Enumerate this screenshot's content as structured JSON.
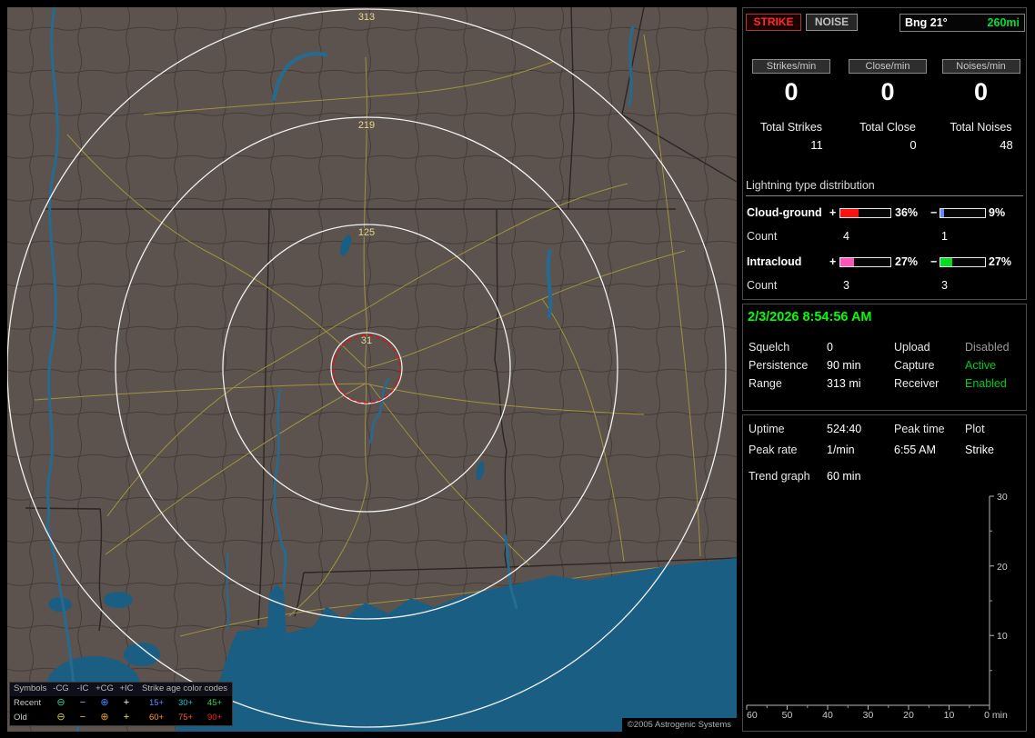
{
  "app": {
    "copyright": "©2005 Astrogenic Systems"
  },
  "colors": {
    "land": "#5c524e",
    "water": "#1a5f83",
    "road": "#a0923e",
    "range_ring": "#f2f2f2",
    "range_label": "#e6d98e",
    "alarm_circle": "#d31616",
    "strike_red": "#ff2a2a",
    "status_green": "#00ff00",
    "bar_plus_cg": "#ff1111",
    "bar_minus_cg": "#6688ff",
    "bar_plus_ic": "#ff55bb",
    "bar_minus_ic": "#00dd22"
  },
  "map": {
    "range_labels": [
      "313",
      "219",
      "125",
      "31"
    ],
    "legend": {
      "symbols_header": "Symbols",
      "col_headers": [
        "-CG",
        "-IC",
        "+CG",
        "+IC"
      ],
      "age_header": "Strike age color codes",
      "rows": [
        {
          "label": "Recent",
          "symbols": [
            "⊖",
            "−",
            "⊕",
            "+"
          ],
          "ages": [
            "15+",
            "30+",
            "45+"
          ]
        },
        {
          "label": "Old",
          "symbols": [
            "⊖",
            "−",
            "⊕",
            "+"
          ],
          "ages": [
            "60+",
            "75+",
            "90+"
          ]
        }
      ]
    }
  },
  "panel": {
    "tabs": {
      "strike": "STRIKE",
      "noise": "NOISE"
    },
    "bearing": {
      "label": "Bng 21°",
      "distance": "260mi"
    },
    "rates": {
      "strikes": {
        "label": "Strikes/min",
        "value": "0"
      },
      "close": {
        "label": "Close/min",
        "value": "0"
      },
      "noises": {
        "label": "Noises/min",
        "value": "0"
      }
    },
    "totals": {
      "strikes": {
        "label": "Total Strikes",
        "value": "11"
      },
      "close": {
        "label": "Total Close",
        "value": "0"
      },
      "noises": {
        "label": "Total Noises",
        "value": "48"
      }
    },
    "distribution": {
      "title": "Lightning type distribution",
      "plus_sign": "+",
      "minus_sign": "−",
      "count_label": "Count",
      "cloud_ground": {
        "label": "Cloud-ground",
        "plus_pct": "36%",
        "plus_w": 36,
        "minus_pct": "9%",
        "minus_w": 9,
        "plus_count": "4",
        "minus_count": "1"
      },
      "intracloud": {
        "label": "Intracloud",
        "plus_pct": "27%",
        "plus_w": 27,
        "minus_pct": "27%",
        "minus_w": 27,
        "plus_count": "3",
        "minus_count": "3"
      }
    },
    "status": {
      "datetime": "2/3/2026 8:54:56 AM",
      "rows": [
        {
          "l1": "Squelch",
          "v1": "0",
          "l2": "Upload",
          "v2": "Disabled"
        },
        {
          "l1": "Persistence",
          "v1": "90 min",
          "l2": "Capture",
          "v2": "Active"
        },
        {
          "l1": "Range",
          "v1": "313 mi",
          "l2": "Receiver",
          "v2": "Enabled"
        }
      ]
    },
    "stats": {
      "uptime_label": "Uptime",
      "uptime_value": "524:40",
      "peak_time_label": "Peak time",
      "peak_time_value": "6:55 AM",
      "plot_label": "Plot",
      "plot_value": "Strike",
      "peak_rate_label": "Peak rate",
      "peak_rate_value": "1/min",
      "trend_label": "Trend graph",
      "trend_value": "60 min"
    },
    "trend": {
      "y_ticks": [
        "30",
        "20",
        "10"
      ],
      "x_ticks": [
        "60",
        "50",
        "40",
        "30",
        "20",
        "10",
        "0 min"
      ]
    }
  }
}
